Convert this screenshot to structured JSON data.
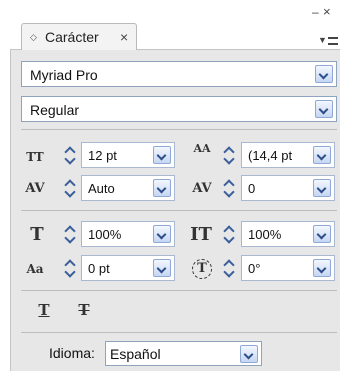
{
  "panel": {
    "tab_label": "Carácter",
    "tab_icon": "expand-diamond-icon",
    "minimize_glyph": "–",
    "close_glyph": "×",
    "accent_color": "#2c4f8c",
    "panel_bg": "#e7e7e7"
  },
  "font": {
    "family": "Myriad Pro",
    "style": "Regular"
  },
  "metrics": {
    "font_size": "12 pt",
    "leading": "(14,4 pt",
    "kerning": "Auto",
    "tracking": "0",
    "vertical_scale": "100%",
    "horizontal_scale": "100%",
    "baseline_shift": "0 pt",
    "rotation": "0°"
  },
  "glyphs": {
    "font_size": "TT",
    "leading": "AA",
    "kerning": "AV",
    "tracking": "AV",
    "vertical_scale": "T",
    "horizontal_scale": "IT",
    "baseline_shift": "Aa",
    "rotation": "T",
    "underline": "T",
    "strikethrough": "T"
  },
  "language": {
    "label": "Idioma:",
    "value": "Español"
  }
}
